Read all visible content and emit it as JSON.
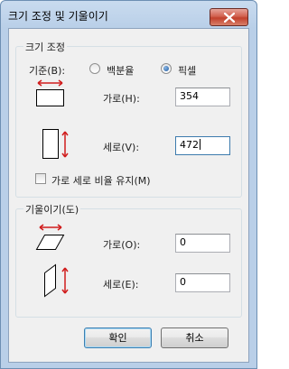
{
  "window": {
    "title": "크기 조정 및 기울이기",
    "close_icon": "close-icon"
  },
  "resize": {
    "group_label": "크기 조정",
    "basis_label": "기준(B):",
    "options": [
      {
        "label": "백분율",
        "selected": false
      },
      {
        "label": "픽셀",
        "selected": true
      }
    ],
    "horizontal_label": "가로(H):",
    "horizontal_value": "354",
    "vertical_label": "세로(V):",
    "vertical_value": "472",
    "keep_ratio_label": "가로 세로 비율 유지(M)",
    "keep_ratio_checked": false
  },
  "skew": {
    "group_label": "기울이기(도)",
    "horizontal_label": "가로(O):",
    "horizontal_value": "0",
    "vertical_label": "세로(E):",
    "vertical_value": "0"
  },
  "buttons": {
    "ok": "확인",
    "cancel": "취소"
  },
  "colors": {
    "arrow": "#d01c1c",
    "accent": "#1e5aa0"
  }
}
